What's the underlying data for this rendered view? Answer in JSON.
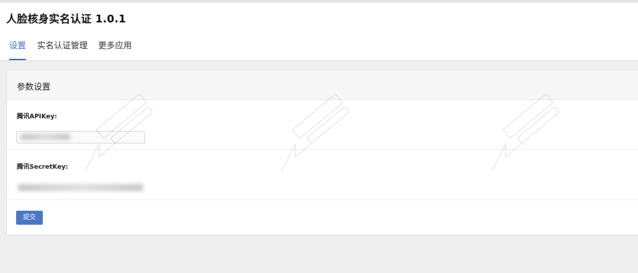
{
  "app": {
    "title": "人脸核身实名认证 1.0.1"
  },
  "tabs": [
    {
      "label": "设置",
      "active": true
    },
    {
      "label": "实名认证管理",
      "active": false
    },
    {
      "label": "更多应用",
      "active": false
    }
  ],
  "panel": {
    "title": "参数设置",
    "fields": [
      {
        "label": "腾讯APIKey:",
        "value_obscured": true
      },
      {
        "label": "腾讯SecretKey:",
        "value_obscured": true
      }
    ],
    "submit_label": "提交"
  },
  "colors": {
    "accent": "#3b6fc9",
    "button": "#4a78c5",
    "background": "#efefef"
  },
  "icons": [
    "discuz-watermark-logo"
  ]
}
